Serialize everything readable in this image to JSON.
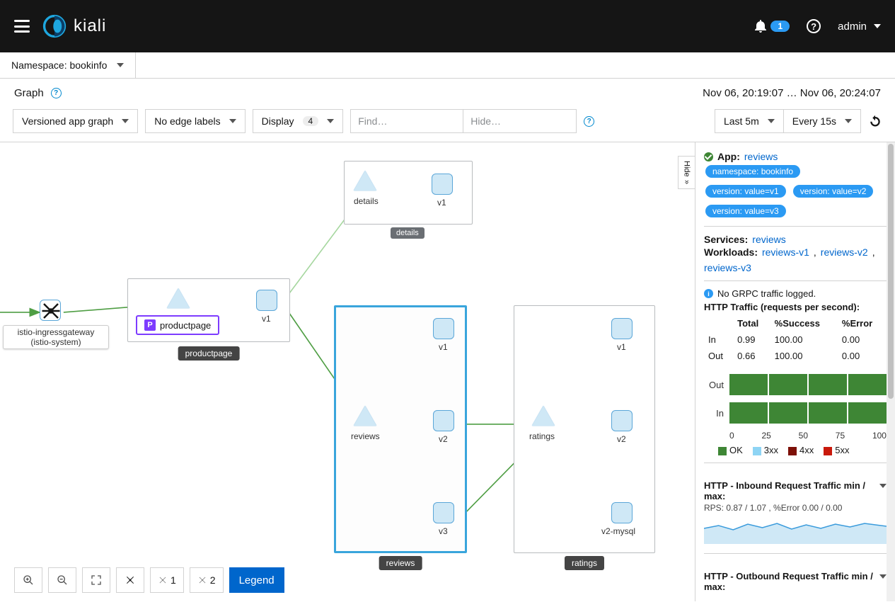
{
  "masthead": {
    "brand": "kiali",
    "notification_count": "1",
    "user": "admin"
  },
  "namespace_selector": {
    "label": "Namespace: bookinfo"
  },
  "page": {
    "title": "Graph",
    "time_range": "Nov 06, 20:19:07 … Nov 06, 20:24:07"
  },
  "toolbar": {
    "graph_type": "Versioned app graph",
    "edge_labels": "No edge labels",
    "display_label": "Display",
    "display_count": "4",
    "find_placeholder": "Find…",
    "hide_placeholder": "Hide…",
    "duration": "Last 5m",
    "refresh_interval": "Every 15s"
  },
  "hide_tab": "Hide",
  "bottom_bar": {
    "layout1": "1",
    "layout2": "2",
    "legend": "Legend"
  },
  "graph": {
    "gateway": {
      "name": "istio-ingressgateway",
      "sub": "(istio-system)"
    },
    "productpage": {
      "app": "productpage",
      "pill": "productpage",
      "v1": "v1",
      "label": "productpage"
    },
    "details": {
      "svc": "details",
      "v1": "v1",
      "label": "details"
    },
    "reviews": {
      "svc": "reviews",
      "v1": "v1",
      "v2": "v2",
      "v3": "v3",
      "label": "reviews"
    },
    "ratings": {
      "svc": "ratings",
      "v1": "v1",
      "v2": "v2",
      "v2mysql": "v2-mysql",
      "label": "ratings"
    }
  },
  "side": {
    "app_label": "App:",
    "app_link": "reviews",
    "tags": [
      "namespace: bookinfo",
      "version: value=v1",
      "version: value=v2",
      "version: value=v3"
    ],
    "services_label": "Services:",
    "services": [
      "reviews"
    ],
    "workloads_label": "Workloads:",
    "workloads": [
      "reviews-v1",
      "reviews-v2",
      "reviews-v3"
    ],
    "no_grpc": "No GRPC traffic logged.",
    "http_title": "HTTP Traffic (requests per second):",
    "table": {
      "headers": [
        "",
        "Total",
        "%Success",
        "%Error"
      ],
      "rows": [
        {
          "dir": "In",
          "total": "0.99",
          "success": "100.00",
          "error": "0.00"
        },
        {
          "dir": "Out",
          "total": "0.66",
          "success": "100.00",
          "error": "0.00"
        }
      ]
    },
    "bars": {
      "rows": [
        {
          "label": "Out"
        },
        {
          "label": "In"
        }
      ],
      "ticks": [
        "0",
        "25",
        "50",
        "75",
        "100"
      ],
      "legend": [
        {
          "name": "OK",
          "color": "#3e8635"
        },
        {
          "name": "3xx",
          "color": "#8ed4f4"
        },
        {
          "name": "4xx",
          "color": "#7d1007"
        },
        {
          "name": "5xx",
          "color": "#c9190b"
        }
      ]
    },
    "inbound": {
      "title": "HTTP - Inbound Request Traffic min / max:",
      "sub": "RPS: 0.87 / 1.07 , %Error 0.00 / 0.00"
    },
    "outbound": {
      "title": "HTTP - Outbound Request Traffic min / max:"
    }
  },
  "chart_data": [
    {
      "type": "bar",
      "title": "HTTP traffic status distribution",
      "categories": [
        "Out",
        "In"
      ],
      "series": [
        {
          "name": "OK",
          "values": [
            100,
            100
          ]
        },
        {
          "name": "3xx",
          "values": [
            0,
            0
          ]
        },
        {
          "name": "4xx",
          "values": [
            0,
            0
          ]
        },
        {
          "name": "5xx",
          "values": [
            0,
            0
          ]
        }
      ],
      "xlabel": "",
      "ylabel": "%",
      "ylim": [
        0,
        100
      ],
      "orientation": "horizontal-stacked"
    },
    {
      "type": "area",
      "title": "HTTP - Inbound Request Traffic",
      "ylabel": "RPS",
      "min": 0.87,
      "max": 1.07,
      "error_min": 0.0,
      "error_max": 0.0
    }
  ]
}
